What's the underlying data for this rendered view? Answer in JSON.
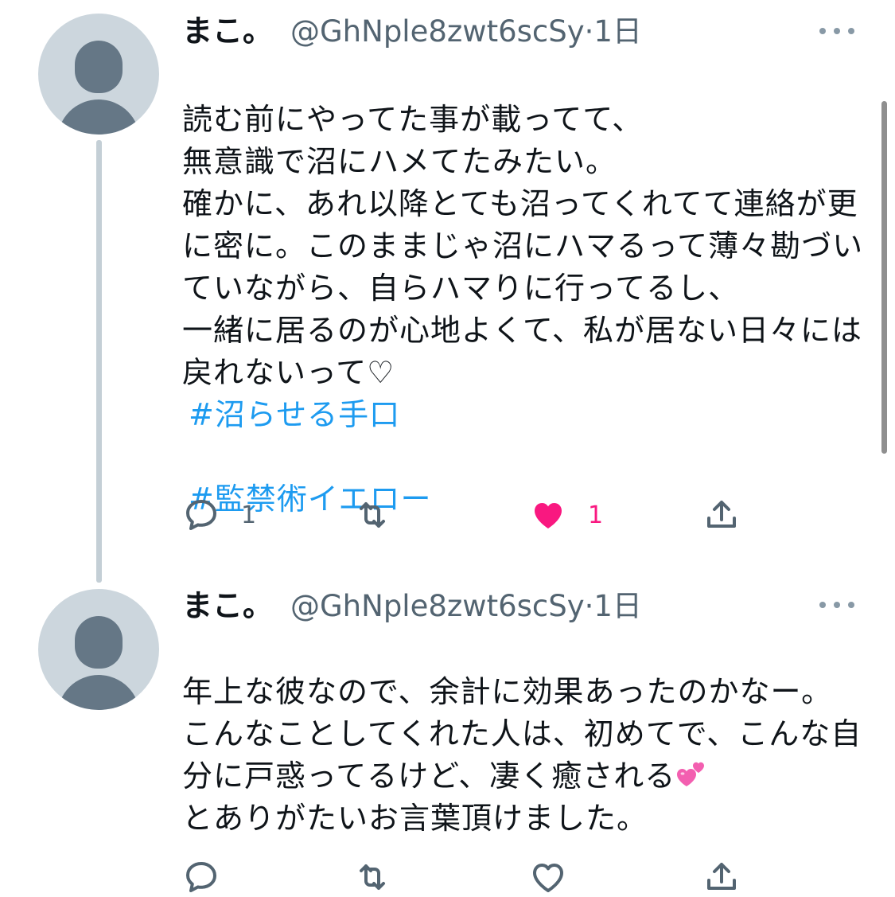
{
  "tweets": [
    {
      "name": "まこ。",
      "handle": "@GhNple8zwt6scSy",
      "separator": "·",
      "time": "1日",
      "body": "読む前にやってた事が載ってて、\n無意識で沼にハメてたみたい。\n確かに、あれ以降とても沼ってくれてて連絡が更に密に。このままじゃ沼にハマるって薄々勘づいていながら、自らハマりに行ってるし、\n一緒に居るのが心地よくて、私が居ない日々には戻れないって♡",
      "hashtags": [
        "#沼らせる手口",
        "#監禁術イエロー"
      ],
      "reply_count": "1",
      "retweet_count": "",
      "like_count": "1",
      "liked": true
    },
    {
      "name": "まこ。",
      "handle": "@GhNple8zwt6scSy",
      "separator": "·",
      "time": "1日",
      "body_part1": "年上な彼なので、余計に効果あったのかなー。\nこんなことしてくれた人は、初めてで、こんな自分に戸惑ってるけど、凄く癒される",
      "body_emoji": "two-hearts-emoji",
      "body_part2": "\nとありがたいお言葉頂けました。",
      "reply_count": "",
      "retweet_count": "",
      "like_count": "",
      "liked": false
    }
  ],
  "icons": {
    "reply": "reply-icon",
    "retweet": "retweet-icon",
    "like": "heart-icon",
    "share": "share-icon",
    "more": "more-icon"
  },
  "colors": {
    "link": "#1d9bf0",
    "like_active": "#f91880",
    "icon_gray": "#536471",
    "avatar_bg": "#ccd6dd",
    "avatar_fg": "#657786"
  }
}
